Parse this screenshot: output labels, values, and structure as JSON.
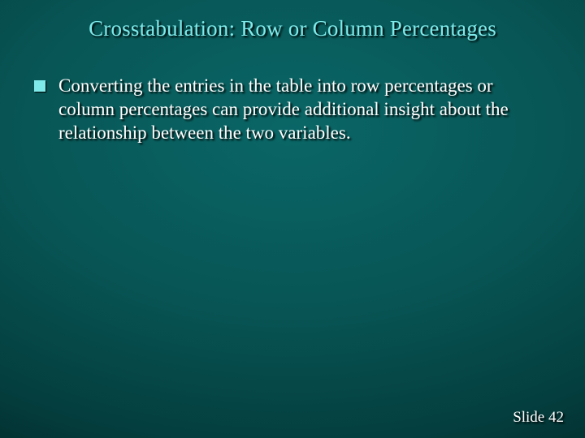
{
  "title": "Crosstabulation: Row or Column Percentages",
  "bullets": [
    {
      "text": "Converting the entries in the table into row percentages or column percentages can provide additional insight about the relationship between the two variables."
    }
  ],
  "footer": {
    "label": "Slide",
    "number": "42"
  }
}
